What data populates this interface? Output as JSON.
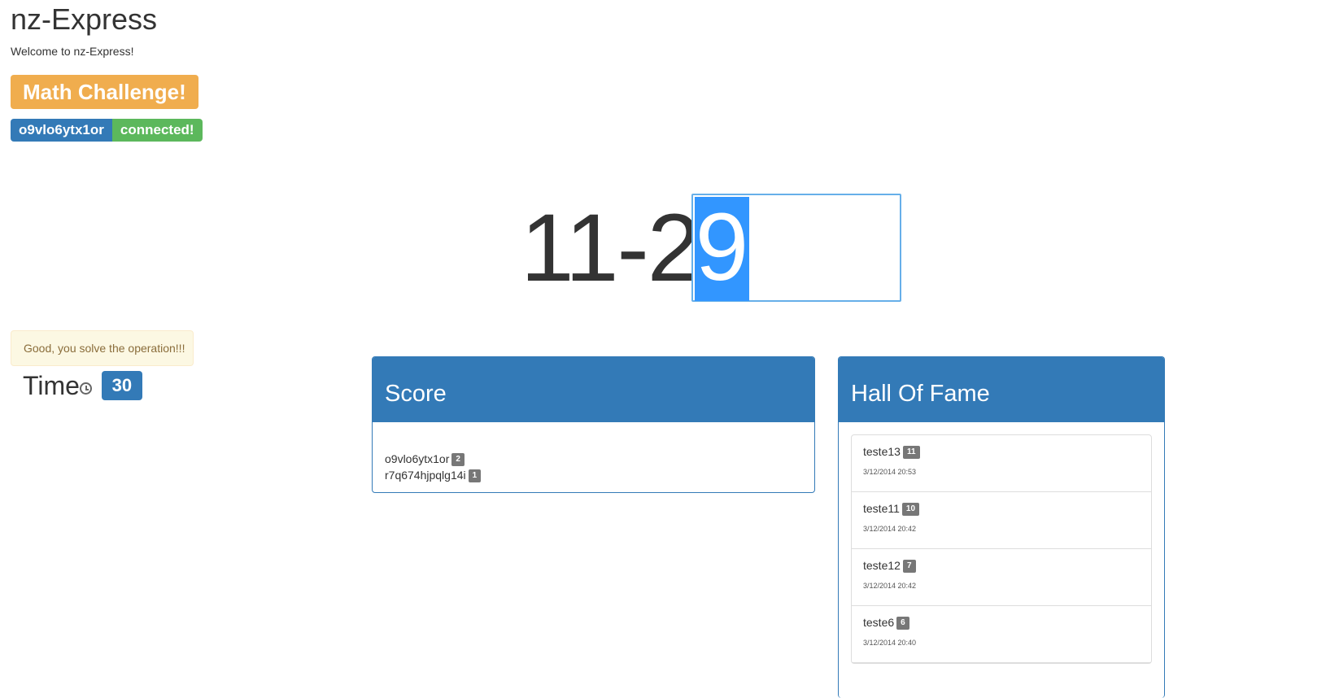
{
  "header": {
    "title": "nz-Express",
    "welcome": "Welcome to nz-Express!",
    "challenge_label": "Math Challenge!",
    "user_id": "o9vlo6ytx1or",
    "status": "connected!"
  },
  "alert": {
    "message": "Good, you solve the operation!!!"
  },
  "timer": {
    "label": "Time",
    "icon": "clock-icon",
    "value": "30"
  },
  "challenge": {
    "operation": "11-2",
    "answer": "9"
  },
  "score": {
    "title": "Score",
    "entries": [
      {
        "name": "o9vlo6ytx1or",
        "points": "2"
      },
      {
        "name": "r7q674hjpqlg14i",
        "points": "1"
      }
    ]
  },
  "hall_of_fame": {
    "title": "Hall Of Fame",
    "entries": [
      {
        "name": "teste13",
        "points": "11",
        "date": "3/12/2014 20:53"
      },
      {
        "name": "teste11",
        "points": "10",
        "date": "3/12/2014 20:42"
      },
      {
        "name": "teste12",
        "points": "7",
        "date": "3/12/2014 20:42"
      },
      {
        "name": "teste6",
        "points": "6",
        "date": "3/12/2014 20:40"
      }
    ]
  },
  "colors": {
    "primary": "#337ab7",
    "warning": "#f0ad4e",
    "success": "#5cb85c",
    "selection": "#3296ff"
  }
}
